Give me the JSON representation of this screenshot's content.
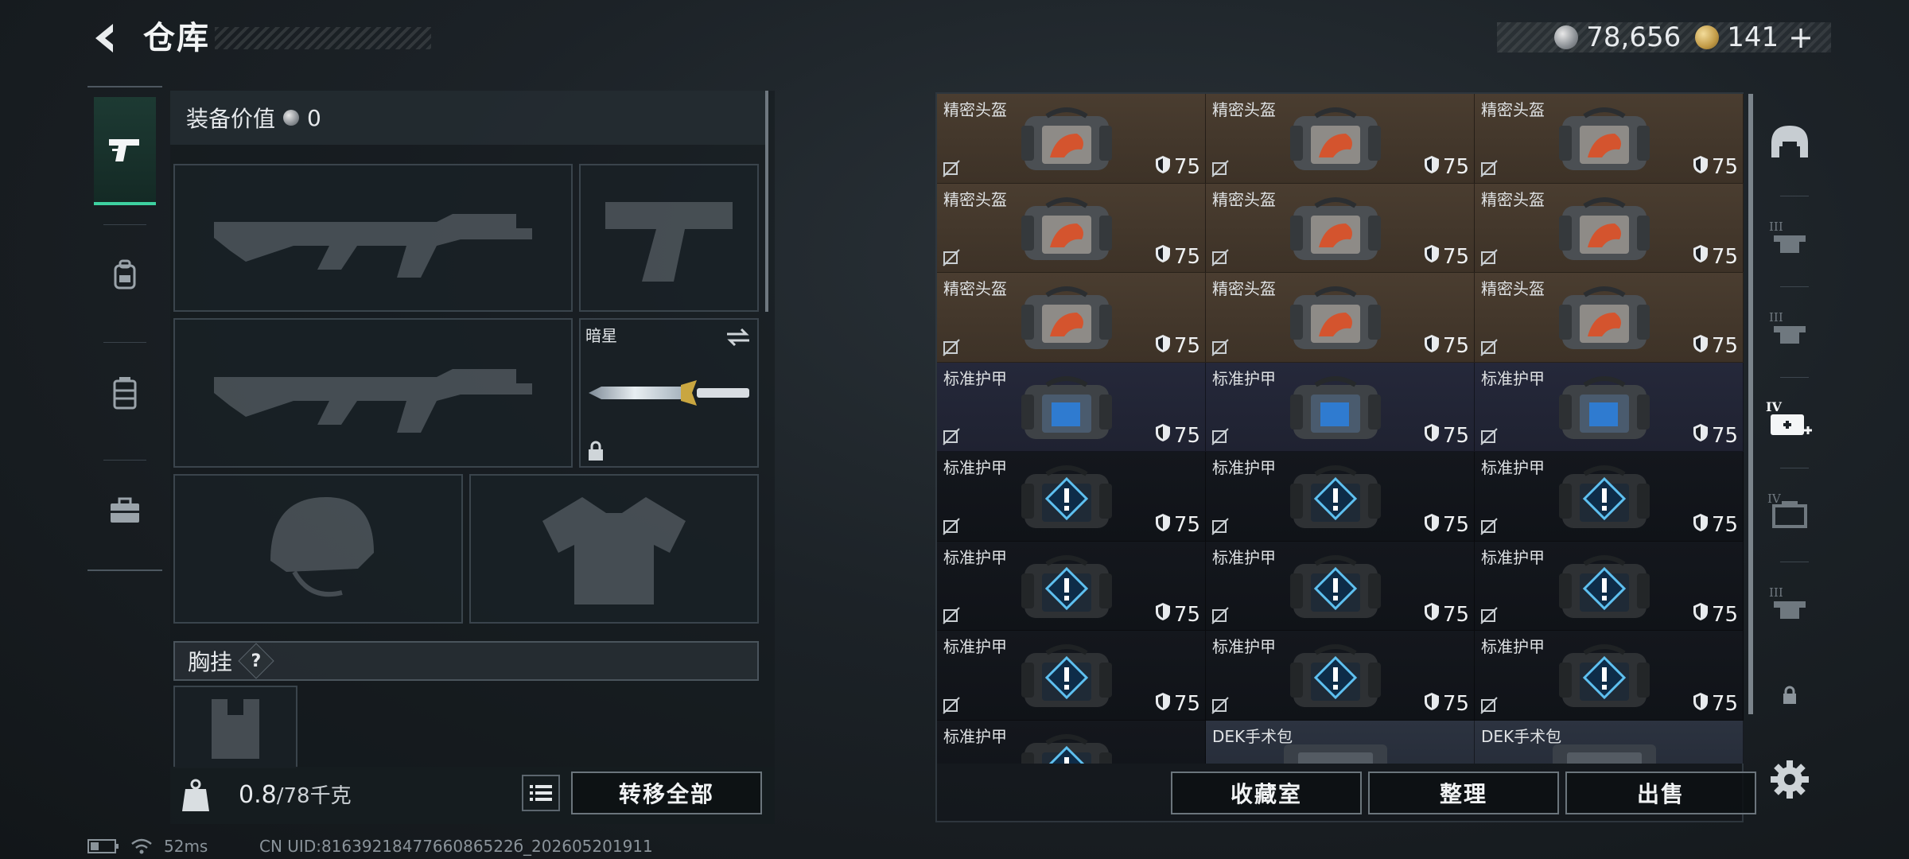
{
  "header": {
    "title": "仓库",
    "back_icon": "back-arrow-icon"
  },
  "currency": {
    "silver": "78,656",
    "gold": "141",
    "add": "+"
  },
  "rail": [
    {
      "name": "pistol-icon",
      "active": true
    },
    {
      "name": "backpack-icon",
      "active": false
    },
    {
      "name": "chest-rig-icon",
      "active": false
    },
    {
      "name": "toolbox-icon",
      "active": false
    }
  ],
  "equipment": {
    "value_label": "装备价值",
    "value": "0",
    "melee_name": "暗星",
    "chest_label": "胸挂",
    "chest_help": "?"
  },
  "footer": {
    "weight_current": "0.8",
    "weight_max": "/78",
    "weight_unit": "千克",
    "weight_icon_label": "KG",
    "transfer_all": "转移全部",
    "collection": "收藏室",
    "organize": "整理",
    "sell": "出售"
  },
  "storage": {
    "items": [
      {
        "name": "精密头盔",
        "type": "helmet",
        "durability": "75"
      },
      {
        "name": "精密头盔",
        "type": "helmet",
        "durability": "75"
      },
      {
        "name": "精密头盔",
        "type": "helmet",
        "durability": "75"
      },
      {
        "name": "精密头盔",
        "type": "helmet",
        "durability": "75"
      },
      {
        "name": "精密头盔",
        "type": "helmet",
        "durability": "75"
      },
      {
        "name": "精密头盔",
        "type": "helmet",
        "durability": "75"
      },
      {
        "name": "精密头盔",
        "type": "helmet",
        "durability": "75"
      },
      {
        "name": "精密头盔",
        "type": "helmet",
        "durability": "75"
      },
      {
        "name": "精密头盔",
        "type": "helmet",
        "durability": "75"
      },
      {
        "name": "标准护甲",
        "type": "armor1",
        "durability": "75"
      },
      {
        "name": "标准护甲",
        "type": "armor1",
        "durability": "75"
      },
      {
        "name": "标准护甲",
        "type": "armor1",
        "durability": "75"
      },
      {
        "name": "标准护甲",
        "type": "armor2",
        "durability": "75"
      },
      {
        "name": "标准护甲",
        "type": "armor2",
        "durability": "75"
      },
      {
        "name": "标准护甲",
        "type": "armor2",
        "durability": "75"
      },
      {
        "name": "标准护甲",
        "type": "armor2",
        "durability": "75"
      },
      {
        "name": "标准护甲",
        "type": "armor2",
        "durability": "75"
      },
      {
        "name": "标准护甲",
        "type": "armor2",
        "durability": "75"
      },
      {
        "name": "标准护甲",
        "type": "armor2",
        "durability": "75"
      },
      {
        "name": "标准护甲",
        "type": "armor2",
        "durability": "75"
      },
      {
        "name": "标准护甲",
        "type": "armor2",
        "durability": "75"
      },
      {
        "name": "标准护甲",
        "type": "armor2",
        "durability": ""
      },
      {
        "name": "DEK手术包",
        "type": "medkit",
        "durability": ""
      },
      {
        "name": "DEK手术包",
        "type": "medkit",
        "durability": ""
      }
    ]
  },
  "filters": [
    {
      "name": "filter-helmet-icon"
    },
    {
      "name": "filter-armor-iii-icon",
      "tier": "III"
    },
    {
      "name": "filter-armor-iii-b-icon",
      "tier": "III"
    },
    {
      "name": "filter-medkit-iv-icon",
      "tier": "IV"
    },
    {
      "name": "filter-box-iv-icon",
      "tier": "IV"
    },
    {
      "name": "filter-armor-iii-c-icon",
      "tier": "III"
    },
    {
      "name": "filter-lock-icon"
    }
  ],
  "status": {
    "ping": "52ms",
    "uid": "CN UID:8163921847766086522б_202605201911"
  }
}
